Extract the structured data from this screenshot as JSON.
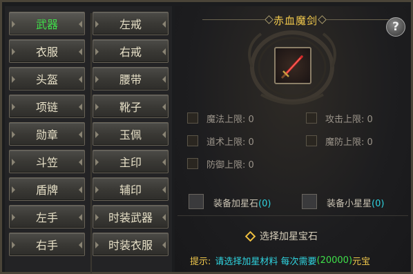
{
  "left_column": [
    "武器",
    "衣服",
    "头盔",
    "项链",
    "勋章",
    "斗笠",
    "盾牌",
    "左手",
    "右手"
  ],
  "right_column": [
    "左戒",
    "右戒",
    "腰带",
    "靴子",
    "玉佩",
    "主印",
    "辅印",
    "时装武器",
    "时装衣服"
  ],
  "active_slot": "武器",
  "item": {
    "name": "赤血魔剑",
    "icon": "red-sword-icon"
  },
  "help_label": "?",
  "stats": {
    "magic_cap_label": "魔法上限: 0",
    "attack_cap_label": "攻击上限: 0",
    "tao_cap_label": "道术上限: 0",
    "magic_def_cap_label": "魔防上限: 0",
    "def_cap_label": "防御上限: 0"
  },
  "star_stone": {
    "label": "装备加星石",
    "count": "(0)"
  },
  "small_star": {
    "label": "装备小星星",
    "count": "(0)"
  },
  "choose_gem_label": "选择加星宝石",
  "hint": {
    "prefix": "提示:",
    "text": "请选择加星材料 每次需要",
    "amount": "(20000)",
    "currency": "元宝"
  },
  "colors": {
    "active_text": "#3fe04a",
    "title_gold": "#f2c94c",
    "count_cyan": "#2fd4e0"
  }
}
